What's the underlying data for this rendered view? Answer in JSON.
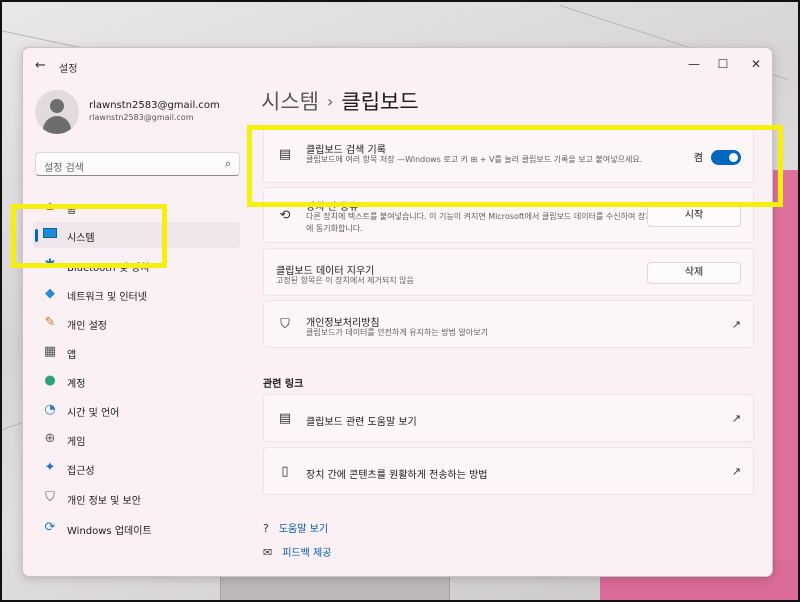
{
  "window": {
    "title": "설정",
    "back_icon": "arrow-left-icon",
    "controls": {
      "minimize": "—",
      "maximize": "☐",
      "close": "✕"
    }
  },
  "account": {
    "name": "rlawnstn2583@gmail.com",
    "email": "rlawnstn2583@gmail.com"
  },
  "search": {
    "placeholder": "설정 검색",
    "icon": "search-icon"
  },
  "sidebar": {
    "items": [
      {
        "label": "홈",
        "icon": "home-icon"
      },
      {
        "label": "시스템",
        "icon": "system-icon",
        "selected": true
      },
      {
        "label": "Bluetooth 및 장치",
        "icon": "bluetooth-icon"
      },
      {
        "label": "네트워크 및 인터넷",
        "icon": "network-icon"
      },
      {
        "label": "개인 설정",
        "icon": "brush-icon"
      },
      {
        "label": "앱",
        "icon": "apps-icon"
      },
      {
        "label": "계정",
        "icon": "account-icon"
      },
      {
        "label": "시간 및 언어",
        "icon": "globe-clock-icon"
      },
      {
        "label": "게임",
        "icon": "gamepad-icon"
      },
      {
        "label": "접근성",
        "icon": "accessibility-icon"
      },
      {
        "label": "개인 정보 및 보안",
        "icon": "shield-icon"
      },
      {
        "label": "Windows 업데이트",
        "icon": "update-icon"
      }
    ]
  },
  "breadcrumb": {
    "parent": "시스템",
    "separator": "›",
    "current": "클립보드"
  },
  "settings": {
    "history": {
      "title": "클립보드 검색 기록",
      "desc": "클립보드에 여러 항목 저장 —Windows 로고 키 ⊞ + V를 눌러 클립보드 기록을 보고 붙여넣으세요.",
      "toggle_label": "켬",
      "toggle_on": true
    },
    "sync": {
      "title": "장치 간 공유",
      "desc": "다른 장치에 텍스트를 붙여넣습니다. 이 기능이 켜지면 Microsoft에서 클립보드 데이터를 수신하여 장치 간에 동기화합니다.",
      "button": "시작"
    },
    "clear": {
      "title": "클립보드 데이터 지우기",
      "desc": "고정된 항목은 이 장치에서 제거되지 않음",
      "button": "삭제"
    },
    "privacy": {
      "title": "개인정보처리방침",
      "desc": "클립보드가 데이터를 안전하게 유지하는 방법 알아보기"
    }
  },
  "related": {
    "heading": "관련 링크",
    "links": [
      {
        "label": "클립보드 관련 도움말 보기",
        "icon": "clipboard-icon"
      },
      {
        "label": "장치 간에 콘텐츠를 원활하게 전송하는 방법",
        "icon": "phone-icon"
      }
    ]
  },
  "help": {
    "get_help": "도움말 보기",
    "feedback": "피드백 제공"
  },
  "colors": {
    "accent": "#0067c0",
    "highlight": "#f6ee0c",
    "window_bg": "#fbf1f4"
  }
}
